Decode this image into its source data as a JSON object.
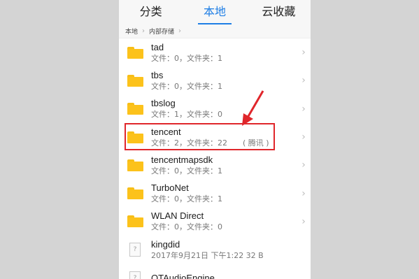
{
  "tabs": [
    {
      "label": "分类",
      "active": false
    },
    {
      "label": "本地",
      "active": true
    },
    {
      "label": "云收藏",
      "active": false
    }
  ],
  "breadcrumb": [
    "本地",
    "内部存储"
  ],
  "files": [
    {
      "name": "tad",
      "meta": "文件：0，文件夹：1",
      "extra": "",
      "icon": "folder-icon"
    },
    {
      "name": "tbs",
      "meta": "文件：0，文件夹：1",
      "extra": "",
      "icon": "folder-icon"
    },
    {
      "name": "tbslog",
      "meta": "文件：1，文件夹：0",
      "extra": "",
      "icon": "folder-icon"
    },
    {
      "name": "tencent",
      "meta": "文件：2，文件夹：22",
      "extra": "( 腾讯 )",
      "icon": "folder-icon"
    },
    {
      "name": "tencentmapsdk",
      "meta": "文件：0，文件夹：1",
      "extra": "",
      "icon": "folder-icon"
    },
    {
      "name": "TurboNet",
      "meta": "文件：0，文件夹：1",
      "extra": "",
      "icon": "folder-icon"
    },
    {
      "name": "WLAN Direct",
      "meta": "文件：0，文件夹：0",
      "extra": "",
      "icon": "folder-icon"
    },
    {
      "name": "kingdid",
      "meta": "2017年9月21日 下午1:22 32 B",
      "extra": "",
      "icon": "unknown-file-icon"
    },
    {
      "name": "QTAudioEngine",
      "meta": "",
      "extra": "",
      "icon": "unknown-file-icon"
    }
  ],
  "icons": {
    "chevron": "chevron-right-icon",
    "unknown_glyph": "?"
  },
  "colors": {
    "accent": "#1e7ee5",
    "highlight": "#e0262b",
    "folder": "#fcc21b"
  }
}
